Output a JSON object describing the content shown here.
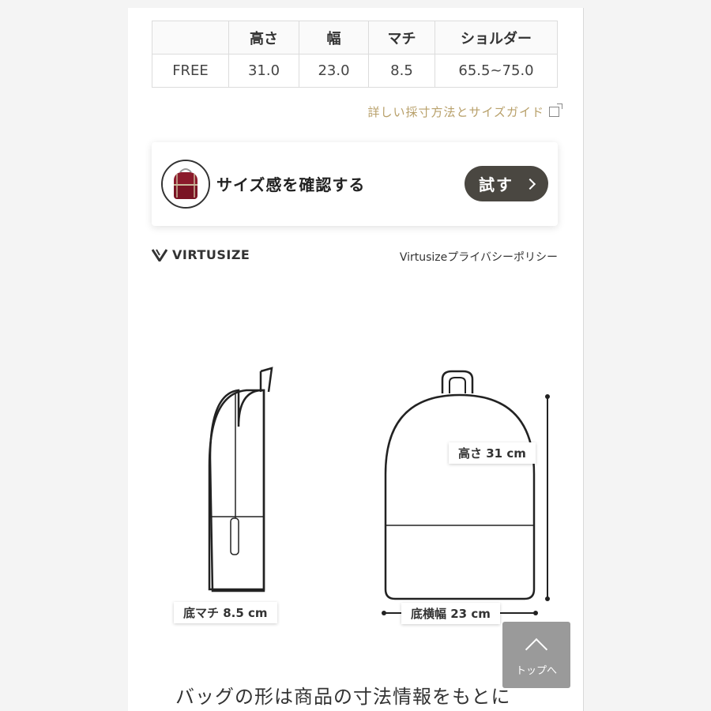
{
  "size_table": {
    "headers": [
      "",
      "高さ",
      "幅",
      "マチ",
      "ショルダー"
    ],
    "rows": [
      [
        "FREE",
        "31.0",
        "23.0",
        "8.5",
        "65.5~75.0"
      ]
    ]
  },
  "guide_link": "詳しい採寸方法とサイズガイド",
  "virtusize": {
    "check_text": "サイズ感を確認する",
    "try_button": "試す",
    "logo_text": "VIRTUSIZE",
    "privacy_link": "Virtusizeプライバシーポリシー"
  },
  "illustration": {
    "side_label": "底マチ 8.5 cm",
    "height_label": "高さ 31 cm",
    "width_label": "底横幅 23 cm"
  },
  "bottom_text": "バッグの形は商品の寸法情報をもとに",
  "to_top": "トップへ",
  "colors": {
    "accent_gold": "#b8a06a",
    "button_dark": "#4a4741",
    "bag_red": "#8b1a2b"
  }
}
